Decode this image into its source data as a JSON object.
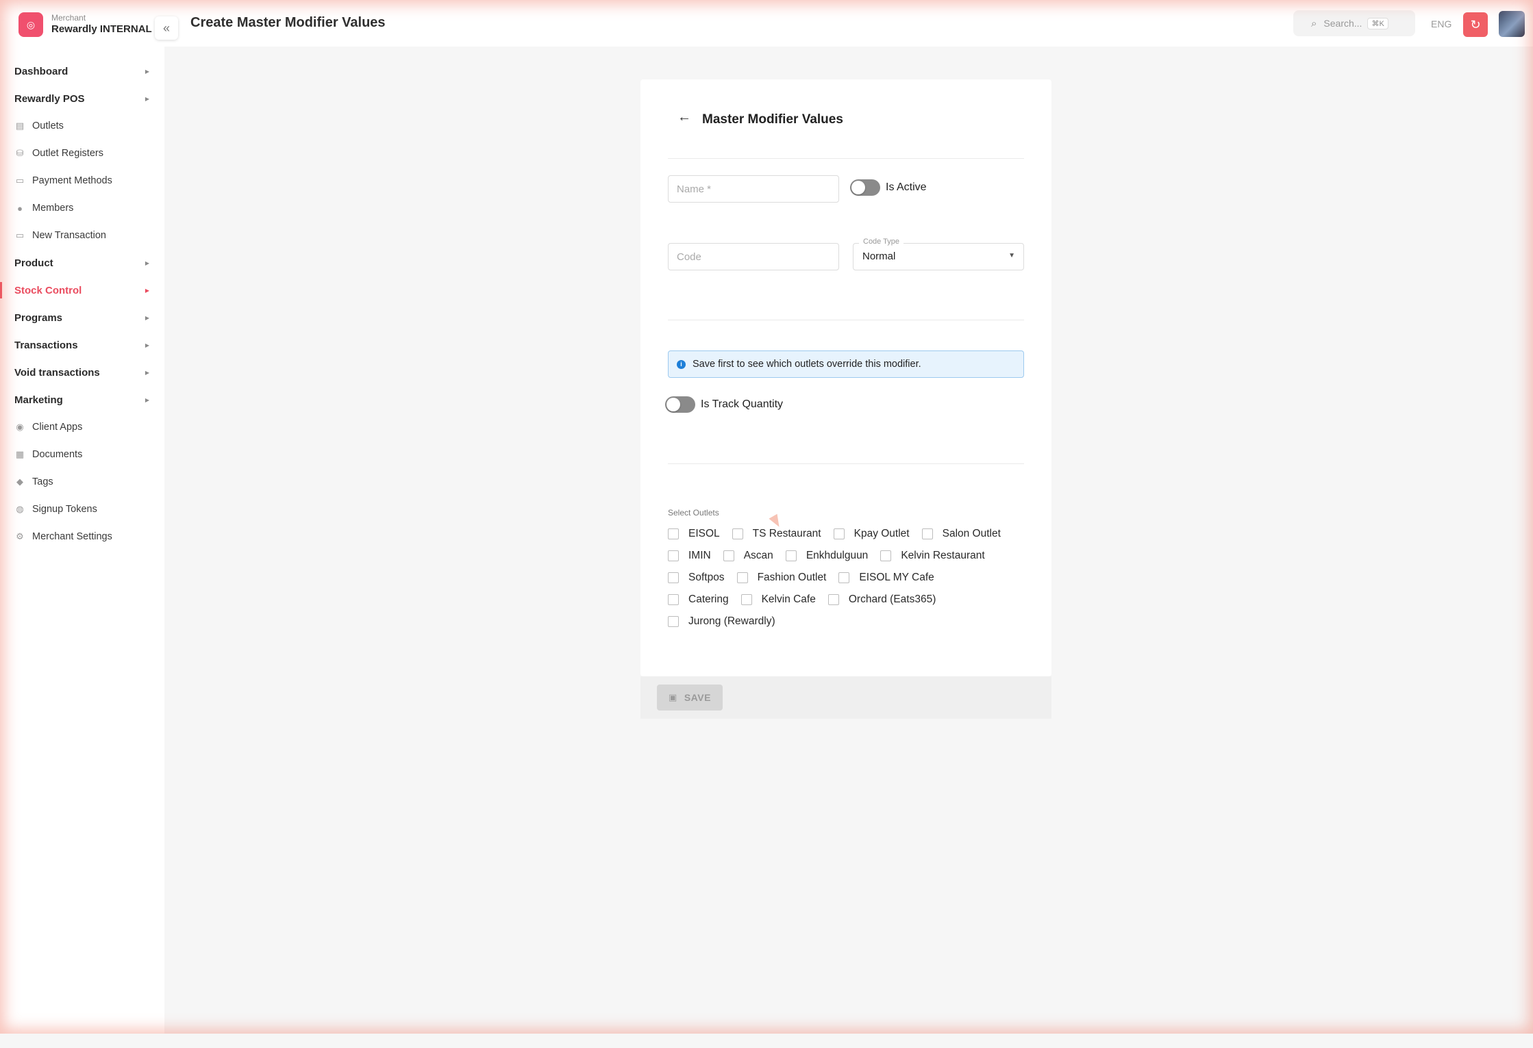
{
  "brand": {
    "subtitle": "Merchant",
    "name": "Rewardly INTERNAL",
    "logo_icon": "rewardly-logo-icon",
    "accent_color": "#f0506e"
  },
  "header": {
    "title": "Create Master Modifier Values",
    "search_placeholder": "Search...",
    "search_shortcut": "⌘K",
    "language": "ENG"
  },
  "sidebar": {
    "items": [
      {
        "label": "Dashboard",
        "type": "section"
      },
      {
        "label": "Rewardly POS",
        "type": "section"
      },
      {
        "label": "Outlets",
        "type": "sub",
        "icon": "store-icon"
      },
      {
        "label": "Outlet Registers",
        "type": "sub",
        "icon": "register-icon"
      },
      {
        "label": "Payment Methods",
        "type": "sub",
        "icon": "payment-icon"
      },
      {
        "label": "Members",
        "type": "sub",
        "icon": "user-icon"
      },
      {
        "label": "New Transaction",
        "type": "sub",
        "icon": "card-icon"
      },
      {
        "label": "Product",
        "type": "section"
      },
      {
        "label": "Stock Control",
        "type": "section",
        "active": true
      },
      {
        "label": "Programs",
        "type": "section"
      },
      {
        "label": "Transactions",
        "type": "section"
      },
      {
        "label": "Void transactions",
        "type": "section"
      },
      {
        "label": "Marketing",
        "type": "section"
      },
      {
        "label": "Client Apps",
        "type": "sub",
        "icon": "app-icon"
      },
      {
        "label": "Documents",
        "type": "sub",
        "icon": "document-icon"
      },
      {
        "label": "Tags",
        "type": "sub",
        "icon": "tag-icon"
      },
      {
        "label": "Signup Tokens",
        "type": "sub",
        "icon": "token-icon"
      },
      {
        "label": "Merchant Settings",
        "type": "sub",
        "icon": "settings-icon"
      }
    ],
    "active_color": "#ea4c5f"
  },
  "form": {
    "title": "Master Modifier Values",
    "name_placeholder": "Name *",
    "is_active_label": "Is Active",
    "is_active": false,
    "code_placeholder": "Code",
    "code_type_label": "Code Type",
    "code_type_value": "Normal",
    "info_text": "Save first to see which outlets override this modifier.",
    "track_quantity_label": "Is Track Quantity",
    "track_quantity": false,
    "outlets_label": "Select Outlets",
    "outlets": [
      [
        "EISOL",
        "TS Restaurant",
        "Kpay Outlet",
        "Salon Outlet"
      ],
      [
        "IMIN",
        "Ascan",
        "Enkhdulguun",
        "Kelvin Restaurant"
      ],
      [
        "Softpos",
        "Fashion Outlet",
        "EISOL MY Cafe"
      ],
      [
        "Catering",
        "Kelvin Cafe",
        "Orchard (Eats365)"
      ],
      [
        "Jurong (Rewardly)"
      ]
    ],
    "save_label": "SAVE"
  }
}
